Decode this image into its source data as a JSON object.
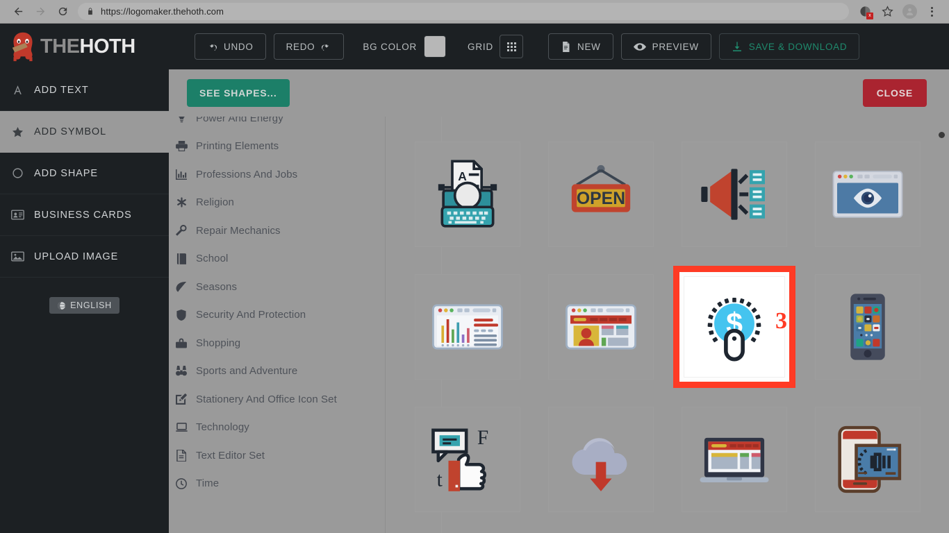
{
  "browser": {
    "url": "https://logomaker.thehoth.com",
    "back_icon": "back-arrow-icon",
    "forward_icon": "forward-arrow-icon",
    "reload_icon": "reload-icon",
    "lock_icon": "lock-icon",
    "extension_icon": "extension-icon",
    "extension_badge": "x",
    "bookmark_icon": "star-icon",
    "profile_icon": "profile-avatar-icon",
    "menu_icon": "kebab-menu-icon"
  },
  "header": {
    "brand_the": "THE",
    "brand_hoth": "HOTH",
    "buttons": {
      "undo": "UNDO",
      "redo": "REDO",
      "bg_color_label": "BG COLOR",
      "bg_color_value": "#b7b7b7",
      "grid_label": "GRID",
      "new": "NEW",
      "preview": "PREVIEW",
      "save_download": "SAVE & DOWNLOAD"
    },
    "accent_save": "#1f8a6d",
    "background": "#1c2023"
  },
  "sidebar": {
    "items": [
      {
        "label": "ADD TEXT",
        "icon": "text-a-icon",
        "active": false
      },
      {
        "label": "ADD SYMBOL",
        "icon": "star-icon",
        "active": true
      },
      {
        "label": "ADD SHAPE",
        "icon": "circle-icon",
        "active": false
      },
      {
        "label": "BUSINESS CARDS",
        "icon": "id-card-icon",
        "active": false
      },
      {
        "label": "UPLOAD IMAGE",
        "icon": "image-upload-icon",
        "active": false
      }
    ],
    "language_button": "ENGLISH",
    "language_icon": "globe-icon"
  },
  "panel": {
    "see_shapes_label": "SEE SHAPES...",
    "see_shapes_color": "#1c7f68",
    "close_label": "CLOSE",
    "close_color": "#aa2430",
    "categories": [
      {
        "label": "Power And Energy",
        "icon": "lightbulb-icon"
      },
      {
        "label": "Printing Elements",
        "icon": "printer-icon"
      },
      {
        "label": "Professions And Jobs",
        "icon": "bar-chart-icon"
      },
      {
        "label": "Religion",
        "icon": "asterisk-icon"
      },
      {
        "label": "Repair Mechanics",
        "icon": "wrench-icon"
      },
      {
        "label": "School",
        "icon": "book-icon"
      },
      {
        "label": "Seasons",
        "icon": "leaf-icon"
      },
      {
        "label": "Security And Protection",
        "icon": "shield-icon"
      },
      {
        "label": "Shopping",
        "icon": "shopping-bag-icon"
      },
      {
        "label": "Sports and Adventure",
        "icon": "binoculars-icon"
      },
      {
        "label": "Stationery And Office Icon Set",
        "icon": "pen-square-icon"
      },
      {
        "label": "Technology",
        "icon": "laptop-icon"
      },
      {
        "label": "Text Editor Set",
        "icon": "file-text-icon"
      },
      {
        "label": "Time",
        "icon": "clock-icon"
      }
    ],
    "symbols": [
      {
        "name": "typewriter-symbol",
        "selected": false
      },
      {
        "name": "open-sign-symbol",
        "selected": false
      },
      {
        "name": "megaphone-list-symbol",
        "selected": false
      },
      {
        "name": "browser-eye-symbol",
        "selected": false
      },
      {
        "name": "analytics-page-symbol",
        "selected": false
      },
      {
        "name": "profile-page-symbol",
        "selected": false
      },
      {
        "name": "dollar-click-symbol",
        "selected": true
      },
      {
        "name": "smartphone-apps-symbol",
        "selected": false
      },
      {
        "name": "thumbs-up-chat-symbol",
        "selected": false
      },
      {
        "name": "cloud-download-symbol",
        "selected": false
      },
      {
        "name": "laptop-layout-symbol",
        "selected": false
      },
      {
        "name": "tablet-code-symbol",
        "selected": false
      }
    ],
    "annotation_marker": "3",
    "annotation_color": "#ff3b25",
    "selection_border_color": "#ff3b25"
  }
}
